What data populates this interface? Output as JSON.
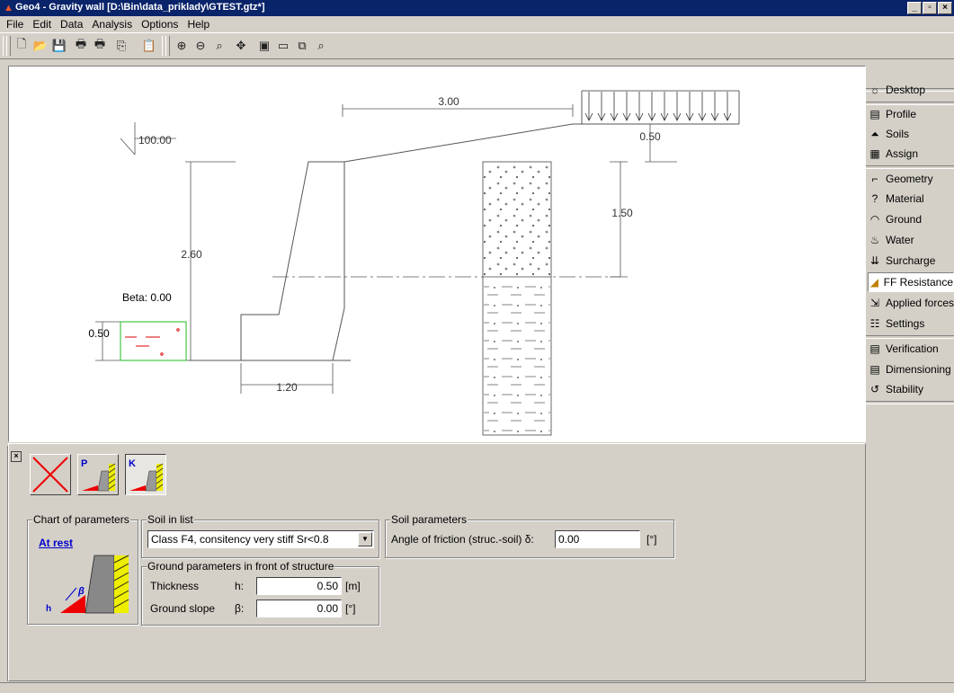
{
  "window": {
    "title": "Geo4 - Gravity wall [D:\\Bin\\data_priklady\\GTEST.gtz*]",
    "buttons": [
      "_",
      "▫",
      "×"
    ]
  },
  "menu": [
    "File",
    "Edit",
    "Data",
    "Analysis",
    "Options",
    "Help"
  ],
  "toolbar": {
    "icons": [
      "new-icon",
      "open-icon",
      "save-icon",
      "print-icon",
      "print-preview-icon",
      "copy-dropdown-icon",
      "paste-icon",
      "zoom-in-icon",
      "zoom-out-icon",
      "zoom-window-icon",
      "pan-icon",
      "fit-icon",
      "zoom-region-icon",
      "zoom-previous-icon",
      "zoom-next-icon"
    ]
  },
  "drawing": {
    "dim_top": "3.00",
    "dim_surcharge_offset": "0.50",
    "elevation": "100.00",
    "dim_height": "2.60",
    "dim_right_height": "1.50",
    "beta_label": "Beta: 0.00",
    "dim_front_thickness": "0.50",
    "dim_base_width": "1.20"
  },
  "sidebar": {
    "items": [
      {
        "label": "Desktop",
        "icon": "desktop-icon"
      },
      {
        "label": "Profile",
        "icon": "profile-icon"
      },
      {
        "label": "Soils",
        "icon": "soils-icon"
      },
      {
        "label": "Assign",
        "icon": "assign-icon"
      },
      {
        "label": "Geometry",
        "icon": "geometry-icon"
      },
      {
        "label": "Material",
        "icon": "material-icon"
      },
      {
        "label": "Ground",
        "icon": "ground-icon"
      },
      {
        "label": "Water",
        "icon": "water-icon"
      },
      {
        "label": "Surcharge",
        "icon": "surcharge-icon"
      },
      {
        "label": "FF Resistance",
        "icon": "ff-resistance-icon",
        "active": true
      },
      {
        "label": "Applied forces",
        "icon": "applied-forces-icon"
      },
      {
        "label": "Settings",
        "icon": "settings-icon"
      },
      {
        "label": "Verification",
        "icon": "verification-icon"
      },
      {
        "label": "Dimensioning",
        "icon": "dimensioning-icon"
      },
      {
        "label": "Stability",
        "icon": "stability-icon"
      }
    ]
  },
  "panel": {
    "buttons": [
      {
        "name": "no-resistance-button",
        "glyph": ""
      },
      {
        "name": "passive-pressure-button",
        "glyph": "P"
      },
      {
        "name": "at-rest-pressure-button",
        "glyph": "K",
        "pressed": true
      }
    ],
    "chart_group": {
      "title": "Chart of parameters",
      "link": "At rest",
      "h_label": "h",
      "beta_label": "β"
    },
    "soil_list": {
      "title": "Soil in list",
      "selected": "Class F4, consitency very stiff Sr<0.8"
    },
    "soil_params": {
      "title": "Soil parameters",
      "label": "Angle of friction (struc.-soil)  δ:",
      "value": "0.00",
      "unit": "[°]"
    },
    "ground_params": {
      "title": "Ground parameters in front of structure",
      "thickness_label": "Thickness",
      "thickness_symbol": "h:",
      "thickness_value": "0.50",
      "thickness_unit": "[m]",
      "slope_label": "Ground slope",
      "slope_symbol": "β:",
      "slope_value": "0.00",
      "slope_unit": "[°]"
    }
  }
}
